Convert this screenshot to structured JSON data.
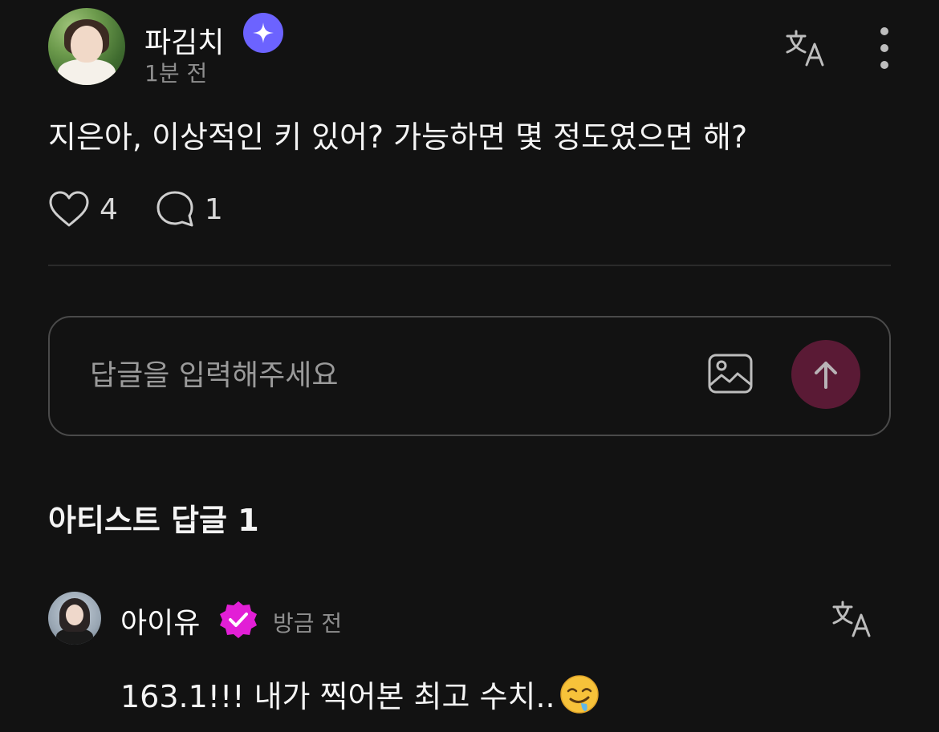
{
  "post": {
    "author": "파김치",
    "timestamp": "1분 전",
    "text": "지은아, 이상적인 키 있어? 가능하면 몇 정도였으면 해?",
    "likes": "4",
    "comments": "1"
  },
  "reply": {
    "placeholder": "답글을 입력해주세요"
  },
  "artist_replies": {
    "title": "아티스트 답글 1"
  },
  "comment": {
    "author": "아이유",
    "timestamp": "방금 전",
    "text": "163.1!!! 내가 찍어본 최고 수치..",
    "emoji": "drooling-face-emoji"
  },
  "colors": {
    "background": "#121212",
    "badge_star": "#6c63ff",
    "badge_check": "#e21fd6",
    "send_button": "#5a1a35"
  }
}
